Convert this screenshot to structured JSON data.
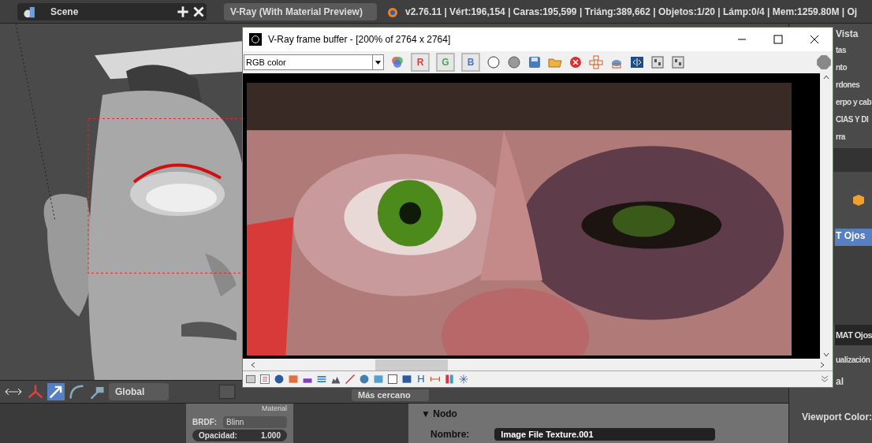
{
  "top_bar": {
    "scene": "Scene",
    "render_engine": "V-Ray (With Material Preview)",
    "stats": "v2.76.11 | Vért:196,154 | Caras:195,599 | Triáng:389,662 | Objetos:1/20 | Lámp:0/4 | Mem:1259.80M | Oj"
  },
  "viewport_header": {
    "orientation": "Global",
    "snap_target": "Más cercano"
  },
  "node": {
    "title": "Material",
    "brdf_label": "BRDF:",
    "brdf": "Blinn",
    "opacity_label": "Opacidad:",
    "opacity": "1.000"
  },
  "node_panel": {
    "heading": "▼ Nodo",
    "name_label": "Nombre:",
    "name": "Image File Texture.001"
  },
  "properties": {
    "tab": "Vista",
    "rows": [
      "tas",
      "nto",
      "rdones",
      "erpo y cab",
      "CIAS Y DI",
      "rra"
    ],
    "slots": [
      {
        "label": "T Ojos",
        "selected": true
      }
    ],
    "material": "MAT Ojos",
    "section": "ualización",
    "setting": "al",
    "viewport_color_label": "Viewport Color:"
  },
  "vray_window": {
    "title": "V-Ray frame buffer - [200% of 2764 x 2764]",
    "channel": "RGB color",
    "channel_toggles": [
      {
        "label": "R",
        "on": true
      },
      {
        "label": "G",
        "on": true
      },
      {
        "label": "B",
        "on": true
      }
    ],
    "bottom_text_tool": "H"
  }
}
